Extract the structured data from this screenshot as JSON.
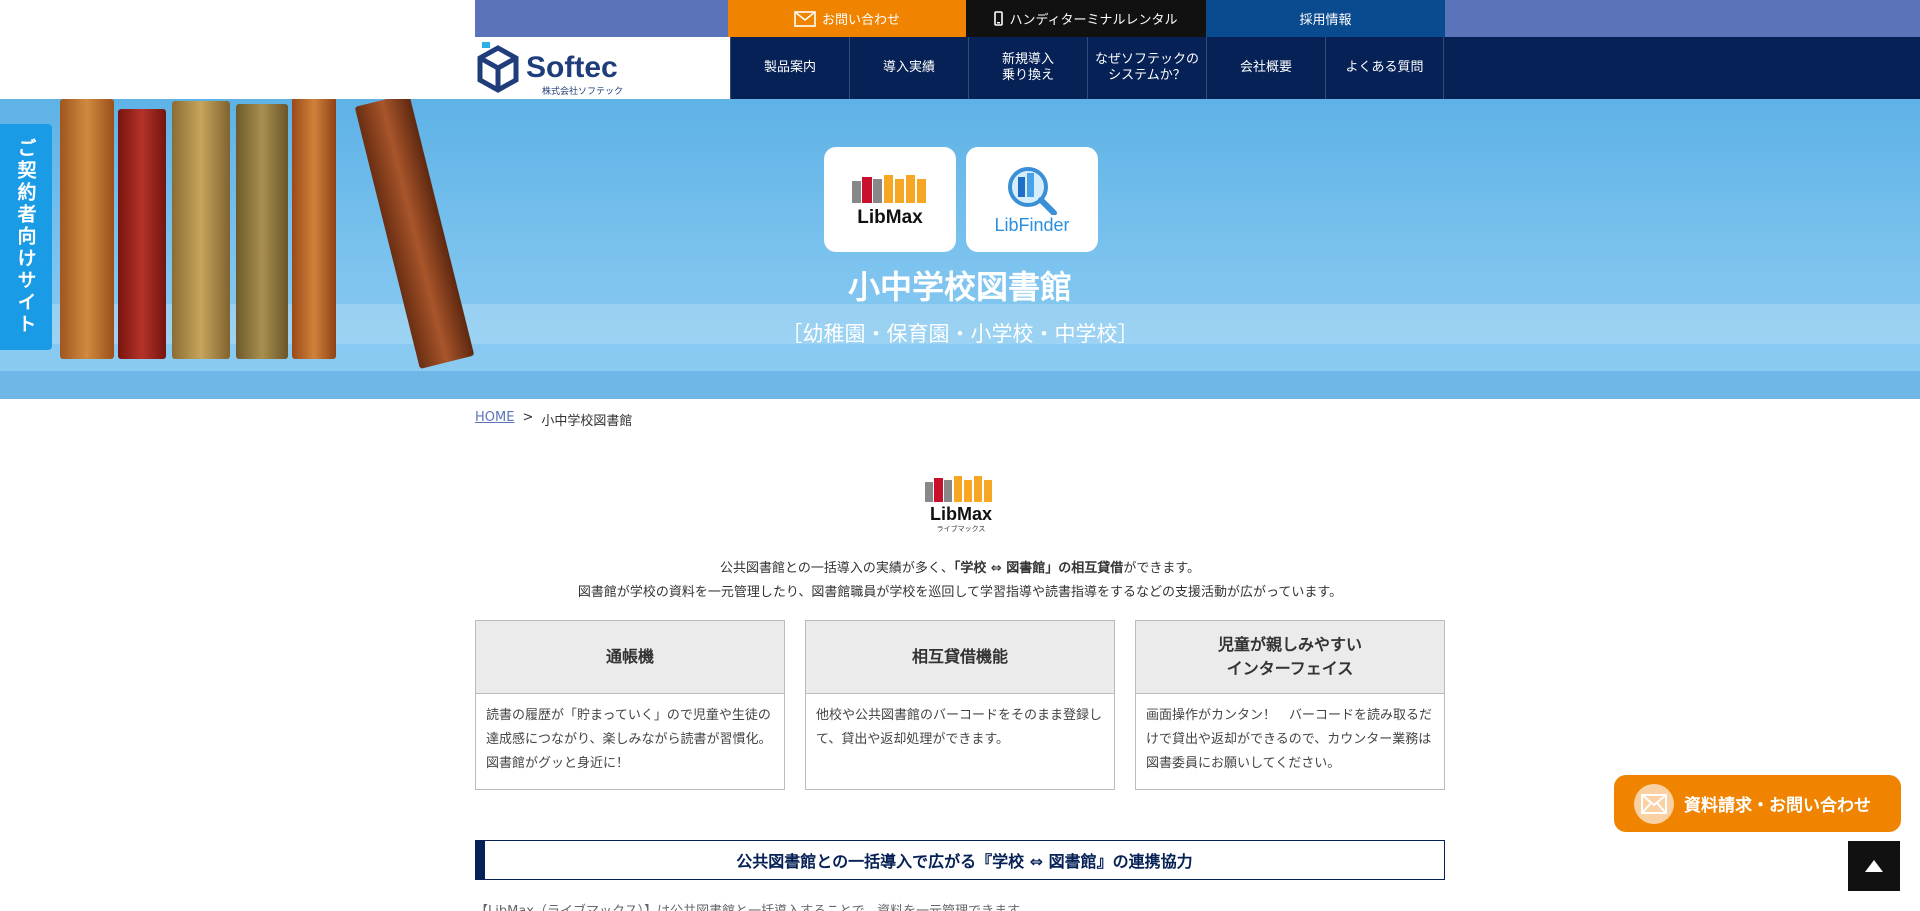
{
  "header": {
    "logo_text": "Softec",
    "logo_sub": "株式会社ソフテック",
    "top_links": {
      "contact": "お問い合わせ",
      "rental": "ハンディターミナルレンタル",
      "recruit": "採用情報"
    },
    "nav": [
      {
        "label": "製品案内"
      },
      {
        "label": "導入実績"
      },
      {
        "label": "新規導入\n乗り換え"
      },
      {
        "label": "なぜソフテックの\nシステムか？"
      },
      {
        "label": "会社概要"
      },
      {
        "label": "よくある質問"
      }
    ]
  },
  "hero": {
    "side_tab": "ご契約者向けサイト",
    "apps": [
      {
        "name": "LibMax"
      },
      {
        "name": "LibFinder"
      }
    ],
    "title": "小中学校図書館",
    "subtitle": "［幼稚園・保育園・小学校・中学校］"
  },
  "breadcrumb": {
    "home": "HOME",
    "separator": ">",
    "current": "小中学校図書館"
  },
  "content": {
    "logo_name": "LibMax",
    "logo_kana": "ライブマックス",
    "intro_line1_pre": "公共図書館との一括導入の実績が多く、",
    "intro_line1_bold": "「学校 ⇔ 図書館」の相互貸借",
    "intro_line1_post": "ができます。",
    "intro_line2": "図書館が学校の資料を一元管理したり、図書館職員が学校を巡回して学習指導や読書指導をするなどの支援活動が広がっています。",
    "cards": [
      {
        "title": "通帳機",
        "body": "読書の履歴が「貯まっていく」ので児童や生徒の達成感につながり、楽しみながら読書が習慣化。図書館がグッと身近に！"
      },
      {
        "title": "相互貸借機能",
        "body": "他校や公共図書館のバーコードをそのまま登録して、貸出や返却処理ができます。"
      },
      {
        "title": "児童が親しみやすい\nインターフェイス",
        "body": "画面操作がカンタン！　バーコードを読み取るだけで貸出や返却ができるので、カウンター業務は図書委員にお願いしてください。"
      }
    ],
    "section_heading": "公共図書館との一括導入で広がる『学校 ⇔ 図書館』の連携協力",
    "bottom_text": "【LibMax（ライブマックス）】は公共図書館と一括導入することで、資料を一元管理できます。"
  },
  "floating": {
    "cta": "資料請求・お問い合わせ"
  },
  "colors": {
    "orange": "#f08300",
    "navy": "#062155",
    "blue_bar": "#5b73b8",
    "sky": "#1a9be6"
  }
}
